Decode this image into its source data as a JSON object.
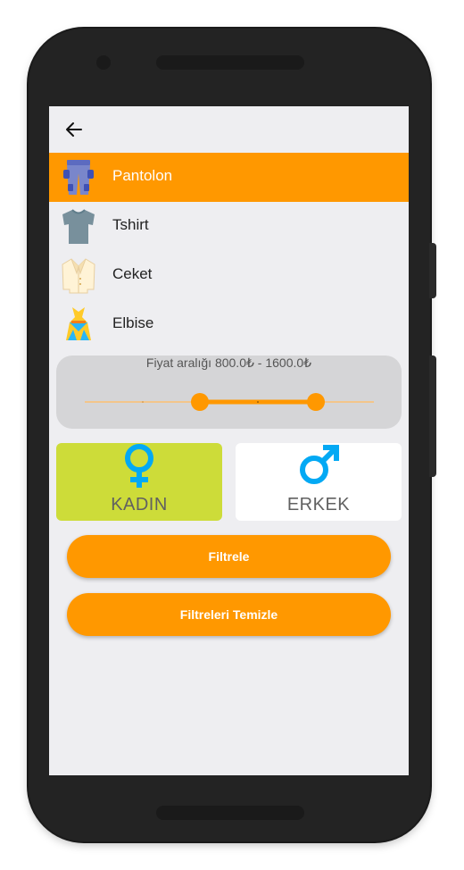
{
  "app": {
    "back_icon": "arrow-left-icon"
  },
  "categories": [
    {
      "label": "Pantolon",
      "icon": "pants-icon",
      "selected": true
    },
    {
      "label": "Tshirt",
      "icon": "tshirt-icon",
      "selected": false
    },
    {
      "label": "Ceket",
      "icon": "jacket-icon",
      "selected": false
    },
    {
      "label": "Elbise",
      "icon": "dress-icon",
      "selected": false
    }
  ],
  "price_filter": {
    "label": "Fiyat aralığı 800.0₺ - 1600.0₺",
    "min_value": 800.0,
    "max_value": 1600.0
  },
  "gender": {
    "female_label": "KADIN",
    "female_icon": "female-symbol-icon",
    "male_label": "ERKEK",
    "male_icon": "male-symbol-icon",
    "selected": "KADIN"
  },
  "actions": {
    "filter_label": "Filtrele",
    "clear_label": "Filtreleri Temizle"
  },
  "colors": {
    "accent": "#ff9800",
    "female_selected": "#cddc39",
    "gender_icon": "#03a9f4",
    "background": "#eeeef1"
  }
}
